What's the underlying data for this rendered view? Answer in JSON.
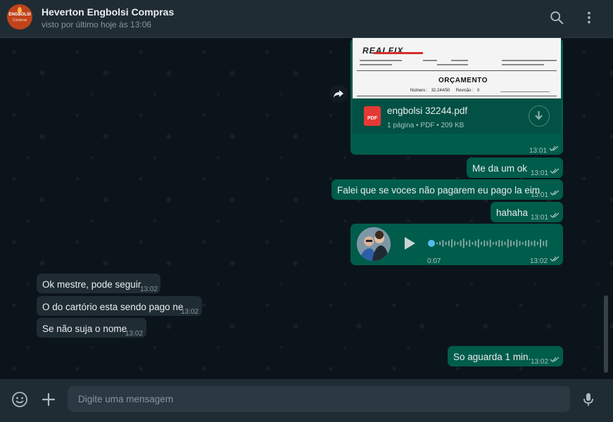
{
  "header": {
    "contact_name": "Heverton Engbolsi Compras",
    "status": "visto por último hoje às 13:06",
    "avatar_text_top": "ENGBOLSI",
    "avatar_text_bottom": "Compras"
  },
  "document_message": {
    "preview_logo": "REALFIX",
    "preview_title": "ORÇAMENTO",
    "preview_numero_label": "Número :",
    "preview_numero": "32.244/50",
    "preview_revisao_label": "Revisão :",
    "preview_revisao": "0",
    "file_icon_label": "PDF",
    "file_name": "engbolsi 32244.pdf",
    "file_meta": "1 página • PDF • 209 KB",
    "time": "13:01"
  },
  "messages": [
    {
      "id": "m1",
      "direction": "out",
      "text": "Me da um ok",
      "time": "13:01"
    },
    {
      "id": "m2",
      "direction": "out",
      "text": "Falei que se voces não pagarem eu pago la eim",
      "time": "13:01"
    },
    {
      "id": "m3",
      "direction": "out",
      "text": "hahaha",
      "time": "13:01"
    },
    {
      "id": "m5",
      "direction": "in",
      "text": "Ok mestre, pode seguir",
      "time": "13:02"
    },
    {
      "id": "m6",
      "direction": "in",
      "text": "O do cartório esta sendo pago ne",
      "time": "13:02"
    },
    {
      "id": "m7",
      "direction": "in",
      "text": "Se não suja o nome",
      "time": "13:02"
    },
    {
      "id": "m8",
      "direction": "out",
      "text": "So aguarda 1 min.",
      "time": "13:02"
    }
  ],
  "voice_message": {
    "duration": "0:07",
    "time": "13:02",
    "progress": 0
  },
  "composer": {
    "placeholder": "Digite uma mensagem"
  },
  "icons": {
    "search": "search-icon",
    "menu": "menu-icon",
    "emoji": "emoji-icon",
    "attach": "plus-icon",
    "mic": "mic-icon",
    "forward": "forward-icon",
    "download": "download-icon",
    "play": "play-icon"
  },
  "colors": {
    "outgoing_bubble": "#005c4b",
    "incoming_bubble": "#202c33",
    "header": "#202c33",
    "background": "#0b141a",
    "read_ticks": "#a6c4bd"
  }
}
